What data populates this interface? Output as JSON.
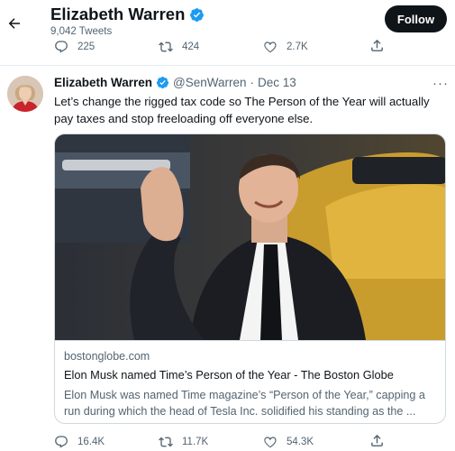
{
  "header": {
    "name": "Elizabeth Warren",
    "tweet_count": "9,042 Tweets",
    "follow_label": "Follow"
  },
  "top_actions": {
    "replies": "225",
    "retweets": "424",
    "likes": "2.7K"
  },
  "tweet": {
    "author_name": "Elizabeth Warren",
    "handle": "@SenWarren",
    "separator": "·",
    "date": "Dec 13",
    "more": "···",
    "text": "Let’s change the rigged tax code so The Person of the Year will actually pay taxes and stop freeloading off everyone else.",
    "card": {
      "domain": "bostonglobe.com",
      "title": "Elon Musk named Time’s Person of the Year - The Boston Globe",
      "description": "Elon Musk was named Time magazine’s “Person of the Year,” capping a run during which the head of Tesla Inc. solidified his standing as the ..."
    },
    "stats": {
      "replies": "16.4K",
      "retweets": "11.7K",
      "likes": "54.3K"
    }
  },
  "colors": {
    "verified": "#1d9bf0",
    "secondary_text": "#536471",
    "follow_bg": "#0f1419"
  },
  "icons": {
    "back": "arrow-left-icon",
    "verified": "verified-badge-icon",
    "reply": "reply-icon",
    "retweet": "retweet-icon",
    "like": "heart-icon",
    "share": "share-icon"
  }
}
